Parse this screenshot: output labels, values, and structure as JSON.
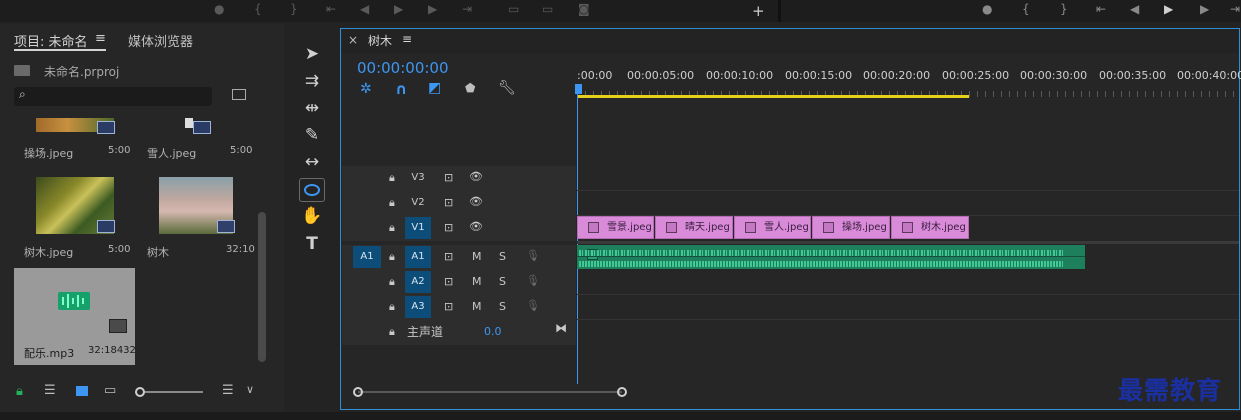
{
  "project_panel": {
    "tab_project": "项目: 未命名",
    "tab_menu": "≡",
    "tab_media": "媒体浏览器",
    "project_file": "未命名.prproj",
    "items": [
      {
        "name": "操场.jpeg",
        "duration": "5:00"
      },
      {
        "name": "雪人.jpeg",
        "duration": "5:00"
      },
      {
        "name": "树木.jpeg",
        "duration": "5:00"
      },
      {
        "name": "树木",
        "duration": "32:10"
      },
      {
        "name": "配乐.mp3",
        "duration": "32:18432"
      }
    ]
  },
  "timeline": {
    "sequence_tab": "树木",
    "close_glyph": "×",
    "menu_glyph": "≡",
    "timecode": "00:00:00:00",
    "ruler": [
      ":00:00",
      "00:00:05:00",
      "00:00:10:00",
      "00:00:15:00",
      "00:00:20:00",
      "00:00:25:00",
      "00:00:30:00",
      "00:00:35:00",
      "00:00:40:00"
    ],
    "video_tracks": [
      "V3",
      "V2",
      "V1"
    ],
    "audio_tracks": [
      "A1",
      "A2",
      "A3"
    ],
    "source_patch": "A1",
    "mute_label": "M",
    "solo_label": "S",
    "master_label": "主声道",
    "master_value": "0.0",
    "clips": [
      "雪景.jpeg",
      "晴天.jpeg",
      "雪人.jpeg",
      "操场.jpeg",
      "树木.jpeg"
    ]
  },
  "watermark": "最需教育",
  "colors": {
    "accent": "#2e8fd6",
    "clip_video": "#d98ad9",
    "clip_audio": "#1e7f5d",
    "playhead_bar": "#e6d21a"
  }
}
